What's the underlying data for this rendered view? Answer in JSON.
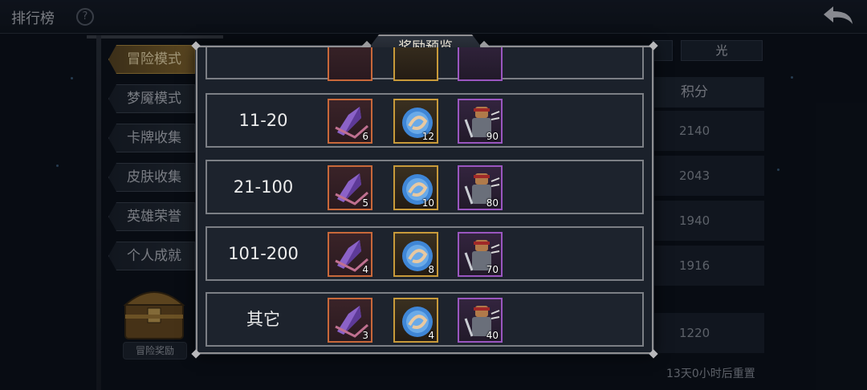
{
  "header": {
    "title": "排行榜",
    "help_icon": "question-icon",
    "back_icon": "back-arrow-icon"
  },
  "sidebar": {
    "items": [
      {
        "label": "冒险模式",
        "active": true
      },
      {
        "label": "梦魇模式",
        "active": false
      },
      {
        "label": "卡牌收集",
        "active": false
      },
      {
        "label": "皮肤收集",
        "active": false
      },
      {
        "label": "英雄荣誉",
        "active": false
      },
      {
        "label": "个人成就",
        "active": false
      }
    ],
    "chest_label": "冒险奖励"
  },
  "ranking": {
    "filter_label": "光",
    "score_header": "积分",
    "scores": [
      "2140",
      "2043",
      "1940",
      "1916",
      "1220"
    ],
    "reset_text": "13天0小时后重置"
  },
  "dialog": {
    "title": "奖励预览",
    "rows": [
      {
        "rank": "11-20",
        "rewards": [
          {
            "icon": "purple-crystal-icon",
            "qty": "6"
          },
          {
            "icon": "blue-rune-coin-icon",
            "qty": "12"
          },
          {
            "icon": "hero-card-icon",
            "qty": "90"
          }
        ]
      },
      {
        "rank": "21-100",
        "rewards": [
          {
            "icon": "purple-crystal-icon",
            "qty": "5"
          },
          {
            "icon": "blue-rune-coin-icon",
            "qty": "10"
          },
          {
            "icon": "hero-card-icon",
            "qty": "80"
          }
        ]
      },
      {
        "rank": "101-200",
        "rewards": [
          {
            "icon": "purple-crystal-icon",
            "qty": "4"
          },
          {
            "icon": "blue-rune-coin-icon",
            "qty": "8"
          },
          {
            "icon": "hero-card-icon",
            "qty": "70"
          }
        ]
      },
      {
        "rank": "其它",
        "rewards": [
          {
            "icon": "purple-crystal-icon",
            "qty": "3"
          },
          {
            "icon": "blue-rune-coin-icon",
            "qty": "4"
          },
          {
            "icon": "hero-card-icon",
            "qty": "40"
          }
        ]
      }
    ]
  },
  "colors": {
    "frame_orange": "#c8683a",
    "frame_gold": "#c89a3a",
    "frame_purple": "#9a56c0",
    "active_tab": "#8a6a2c"
  }
}
